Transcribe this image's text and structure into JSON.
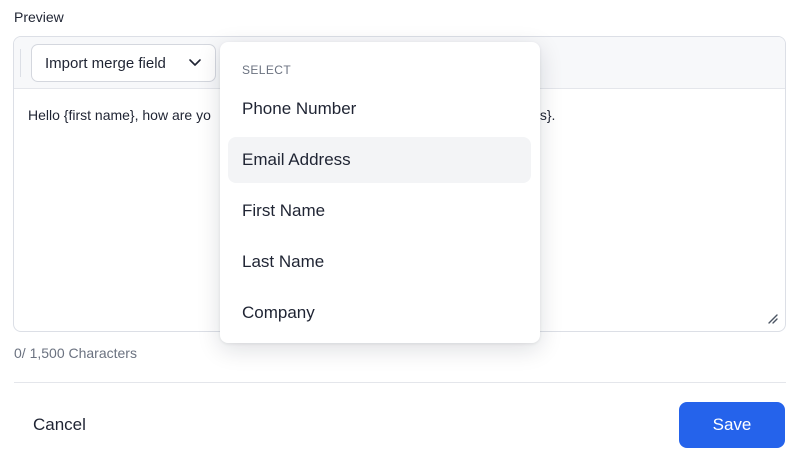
{
  "preview_label": "Preview",
  "toolbar": {
    "merge_button_label": "Import merge field",
    "merge_button_icon": "chevron-down-icon"
  },
  "editor": {
    "text_before": "Hello {first name}, how are yo",
    "text_after": "s}."
  },
  "char_count": "0/ 1,500 Characters",
  "dropdown": {
    "header": "SELECT",
    "items": [
      {
        "label": "Phone Number"
      },
      {
        "label": "Email Address",
        "highlighted": true
      },
      {
        "label": "First Name"
      },
      {
        "label": "Last Name"
      },
      {
        "label": "Company"
      }
    ]
  },
  "footer": {
    "cancel_label": "Cancel",
    "save_label": "Save"
  },
  "colors": {
    "primary": "#2563eb",
    "text": "#1f2433",
    "muted": "#6b7280",
    "hover": "#f3f4f6"
  }
}
